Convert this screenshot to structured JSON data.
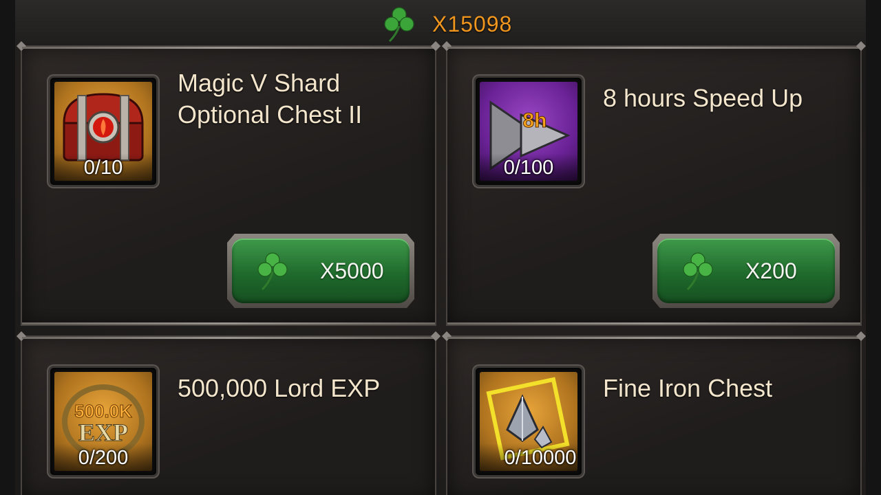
{
  "header": {
    "currency_amount": "X15098",
    "currency_icon": "clover-icon"
  },
  "items": [
    {
      "title_line1": "Magic V Shard",
      "title_line2": "Optional Chest II",
      "count": "0/10",
      "icon": "red-treasure-chest-icon",
      "price": "X5000"
    },
    {
      "title_line1": "8 hours Speed Up",
      "title_line2": "",
      "count": "0/100",
      "icon": "speed-up-arrow-icon",
      "icon_label": "8h",
      "price": "X200"
    },
    {
      "title_line1": "500,000 Lord EXP",
      "title_line2": "",
      "count": "0/200",
      "icon": "exp-badge-icon",
      "icon_label_top": "500.0K",
      "icon_label_bottom": "EXP"
    },
    {
      "title_line1": "Fine Iron Chest",
      "title_line2": "",
      "count": "0/10000",
      "icon": "iron-crystal-icon"
    }
  ],
  "colors": {
    "accent": "#f0961e",
    "button_green": "#2a7c36",
    "title_text": "#f3e6cc"
  }
}
